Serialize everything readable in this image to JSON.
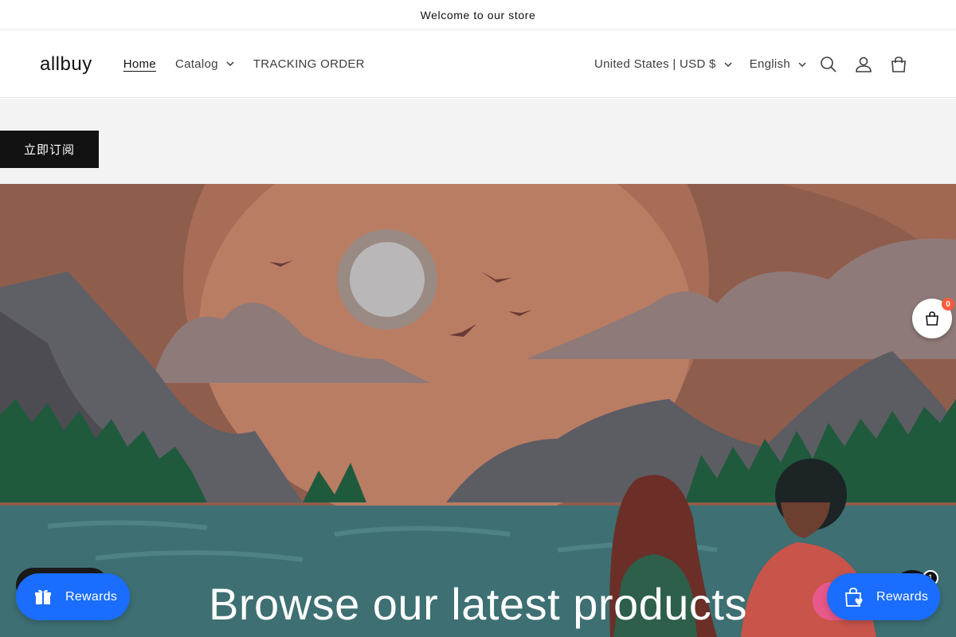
{
  "announcement": {
    "text": "Welcome to our store"
  },
  "header": {
    "logo": "allbuy",
    "nav": [
      {
        "label": "Home",
        "active": true
      },
      {
        "label": "Catalog",
        "has_dropdown": true
      },
      {
        "label": "TRACKING ORDER"
      }
    ],
    "country_selector": "United States | USD $",
    "language_selector": "English",
    "icons": [
      "search-icon",
      "account-icon",
      "cart-icon"
    ]
  },
  "subscribe": {
    "label": "立即订阅"
  },
  "hero": {
    "title": "Browse our latest products"
  },
  "floating": {
    "cart_count": "0",
    "rewards_left_label": "Rewards",
    "rewards_right_label": "Rewards",
    "chat_badge": "1"
  },
  "colors": {
    "accent_blue": "#1a6dff",
    "dark": "#121212",
    "badge_orange": "#ff5a3c",
    "pink": "#e8588a"
  }
}
